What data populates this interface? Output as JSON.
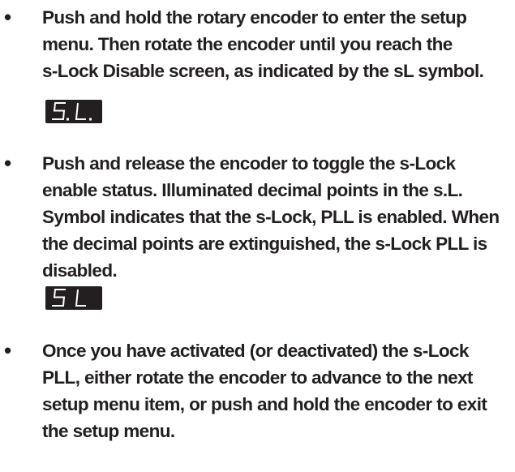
{
  "bullet_glyph": "•",
  "steps": [
    {
      "text": "Push and hold the rotary encoder to enter the setup\nmenu. Then rotate the encoder until you reach the\ns-Lock Disable screen, as indicated by the sL symbol.",
      "display": {
        "chars": [
          "5",
          "L"
        ],
        "decimal_points": true
      }
    },
    {
      "text": "Push and release the encoder to toggle the s-Lock\nenable status.   Illuminated decimal points in the s.L.\nSymbol indicates that the s-Lock, PLL is enabled.   When\nthe decimal points are extinguished, the s-Lock PLL is\ndisabled.",
      "display": {
        "chars": [
          "5",
          "L"
        ],
        "decimal_points": false
      }
    },
    {
      "text": "Once you have activated (or deactivated) the s-Lock\nPLL, either rotate the encoder to advance to the next\nsetup menu item, or push and hold the encoder to exit\nthe setup menu."
    }
  ],
  "colors": {
    "text": "#231f20",
    "display_background": "#231f20",
    "display_segment": "#ffffff"
  }
}
